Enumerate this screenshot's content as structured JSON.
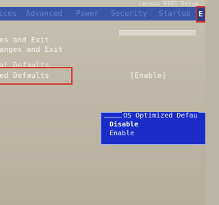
{
  "bios": {
    "title": "Lenovo BIOS Setup"
  },
  "menu": {
    "items": [
      "ices",
      "Advanced",
      "Power",
      "Security",
      "Startup"
    ],
    "exit_tab": "E"
  },
  "options": [
    "es and Exit",
    "anges and Exit",
    "al Defaults",
    "ed Defaults"
  ],
  "selected_value": "[Enable]",
  "popup": {
    "title": "OS Optimized Defau",
    "choices": [
      "Disable",
      "Enable"
    ]
  },
  "colors": {
    "menu_bar": "#3a55a6",
    "highlight_box": "#d93a34",
    "popup_bg": "#1a2dc9"
  }
}
